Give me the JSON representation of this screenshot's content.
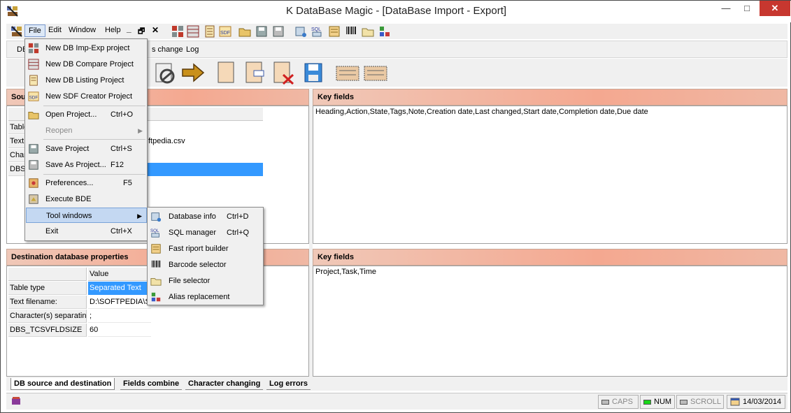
{
  "window": {
    "title": "K DataBase Magic - [DataBase Import - Export]",
    "close_glyph": "✕",
    "max_glyph": "□",
    "min_glyph": "—"
  },
  "menubar": {
    "items": [
      "File",
      "Edit",
      "Window",
      "Help"
    ],
    "mdi_min": "_",
    "mdi_restore": "🗗",
    "mdi_close": "✕"
  },
  "docbar": {
    "tab_partial": "DB",
    "items": [
      "s change",
      "Log"
    ]
  },
  "source_panel": {
    "header_partial": "Sou",
    "rows_partial": [
      "Table",
      "Text",
      "Char",
      "DBS_"
    ],
    "text_filename_partial": "ftpedia.csv"
  },
  "key_fields_top": {
    "header": "Key fields",
    "value": "Heading,Action,State,Tags,Note,Creation date,Last changed,Start date,Completion date,Due date"
  },
  "destination_panel": {
    "header": "Destination database properties",
    "value_col": "Value",
    "rows": [
      {
        "label": "Table type",
        "value": "Separated Text"
      },
      {
        "label": "Text filename:",
        "value": "D:\\SOFTPEDIA\\So"
      },
      {
        "label": "Character(s) separatin",
        "value": ";"
      },
      {
        "label": "DBS_TCSVFLDSIZE",
        "value": "60"
      }
    ]
  },
  "key_fields_bottom": {
    "header": "Key fields",
    "value": "Project,Task,Time"
  },
  "bottom_tabs": [
    "DB source and destination",
    "Fields combine",
    "Character changing",
    "Log errors"
  ],
  "statusbar": {
    "caps": "CAPS",
    "num": "NUM",
    "scroll": "SCROLL",
    "date": "14/03/2014"
  },
  "file_menu": {
    "items": [
      {
        "label": "New DB Imp-Exp project",
        "shortcut": "",
        "icon": "imp-exp-icon"
      },
      {
        "label": "New DB Compare Project",
        "shortcut": "",
        "icon": "compare-icon"
      },
      {
        "label": "New DB Listing Project",
        "shortcut": "",
        "icon": "listing-icon"
      },
      {
        "label": "New SDF Creator Project",
        "shortcut": "",
        "icon": "sdf-icon"
      },
      {
        "label": "Open Project...",
        "shortcut": "Ctrl+O",
        "icon": "open-folder-icon"
      },
      {
        "label": "Reopen",
        "shortcut": "",
        "icon": ""
      },
      {
        "label": "Save Project",
        "shortcut": "Ctrl+S",
        "icon": "save-icon"
      },
      {
        "label": "Save As Project...",
        "shortcut": "F12",
        "icon": "save-as-icon"
      },
      {
        "label": "Preferences...",
        "shortcut": "F5",
        "icon": "preferences-icon"
      },
      {
        "label": "Execute BDE",
        "shortcut": "",
        "icon": "bde-icon"
      },
      {
        "label": "Tool windows",
        "shortcut": "",
        "icon": ""
      },
      {
        "label": "Exit",
        "shortcut": "Ctrl+X",
        "icon": ""
      }
    ]
  },
  "tool_windows_menu": {
    "items": [
      {
        "label": "Database info",
        "shortcut": "Ctrl+D",
        "icon": "database-info-icon"
      },
      {
        "label": "SQL manager",
        "shortcut": "Ctrl+Q",
        "icon": "sql-icon"
      },
      {
        "label": "Fast riport builder",
        "shortcut": "",
        "icon": "report-icon"
      },
      {
        "label": "Barcode selector",
        "shortcut": "",
        "icon": "barcode-icon"
      },
      {
        "label": "File selector",
        "shortcut": "",
        "icon": "file-selector-icon"
      },
      {
        "label": "Alias replacement",
        "shortcut": "",
        "icon": "alias-icon"
      }
    ]
  },
  "colors": {
    "header_gradient": "#f4a890",
    "selection": "#3399ff",
    "menu_highlight": "#c4d8f2"
  }
}
